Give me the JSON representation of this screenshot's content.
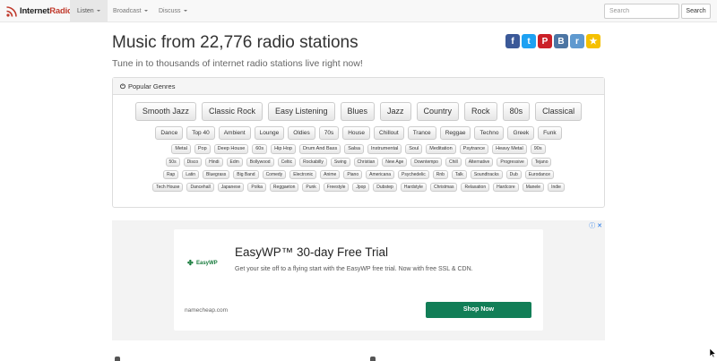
{
  "brand": {
    "part1": "Internet",
    "part2": "Radio"
  },
  "nav": {
    "items": [
      {
        "label": "Listen",
        "active": true
      },
      {
        "label": "Broadcast",
        "active": false
      },
      {
        "label": "Discuss",
        "active": false
      }
    ],
    "search_placeholder": "Search",
    "search_button": "Search"
  },
  "header": {
    "title": "Music from 22,776 radio stations",
    "subtitle": "Tune in to thousands of internet radio stations live right now!"
  },
  "social": [
    {
      "icon": "facebook-icon",
      "glyph": "f",
      "color": "#3b5998"
    },
    {
      "icon": "twitter-icon",
      "glyph": "t",
      "color": "#1da1f2"
    },
    {
      "icon": "pinterest-icon",
      "glyph": "P",
      "color": "#cb2027"
    },
    {
      "icon": "vk-icon",
      "glyph": "В",
      "color": "#4c75a3"
    },
    {
      "icon": "reddit-icon",
      "glyph": "r",
      "color": "#5f99cf"
    },
    {
      "icon": "favorite-star-icon",
      "glyph": "★",
      "color": "#f5c000"
    }
  ],
  "genres_panel": {
    "heading": "Popular Genres",
    "rows": [
      [
        "Smooth Jazz",
        "Classic Rock",
        "Easy Listening",
        "Blues",
        "Jazz",
        "Country",
        "Rock",
        "80s",
        "Classical"
      ],
      [
        "Dance",
        "Top 40",
        "Ambient",
        "Lounge",
        "Oldies",
        "70s",
        "House",
        "Chillout",
        "Trance",
        "Reggae",
        "Techno",
        "Greek",
        "Funk"
      ],
      [
        "Metal",
        "Pop",
        "Deep House",
        "60s",
        "Hip Hop",
        "Drum And Bass",
        "Salsa",
        "Instrumental",
        "Soul",
        "Meditation",
        "Psytrance",
        "Heavy Metal",
        "90s"
      ],
      [
        "50s",
        "Disco",
        "Hindi",
        "Edm",
        "Bollywood",
        "Celtic",
        "Rockabilly",
        "Swing",
        "Christian",
        "New Age",
        "Downtempo",
        "Chill",
        "Alternative",
        "Progressive",
        "Tejano"
      ],
      [
        "Rap",
        "Latin",
        "Bluegrass",
        "Big Band",
        "Comedy",
        "Electronic",
        "Anime",
        "Piano",
        "Americana",
        "Psychedelic",
        "Rnb",
        "Talk",
        "Soundtracks",
        "Dub",
        "Eurodance"
      ],
      [
        "Tech House",
        "Dancehall",
        "Japanese",
        "Polka",
        "Reggaeton",
        "Punk",
        "Freestyle",
        "Jpop",
        "Dubstep",
        "Hardstyle",
        "Christmas",
        "Relaxation",
        "Hardcore",
        "Manele",
        "Indie"
      ]
    ]
  },
  "ad": {
    "logo_text": "EasyWP",
    "title": "EasyWP™ 30-day Free Trial",
    "text": "Get your site off to a flying start with the EasyWP free trial. Now with free SSL & CDN.",
    "domain": "namecheap.com",
    "cta": "Shop Now",
    "cta_color": "#127e57"
  }
}
